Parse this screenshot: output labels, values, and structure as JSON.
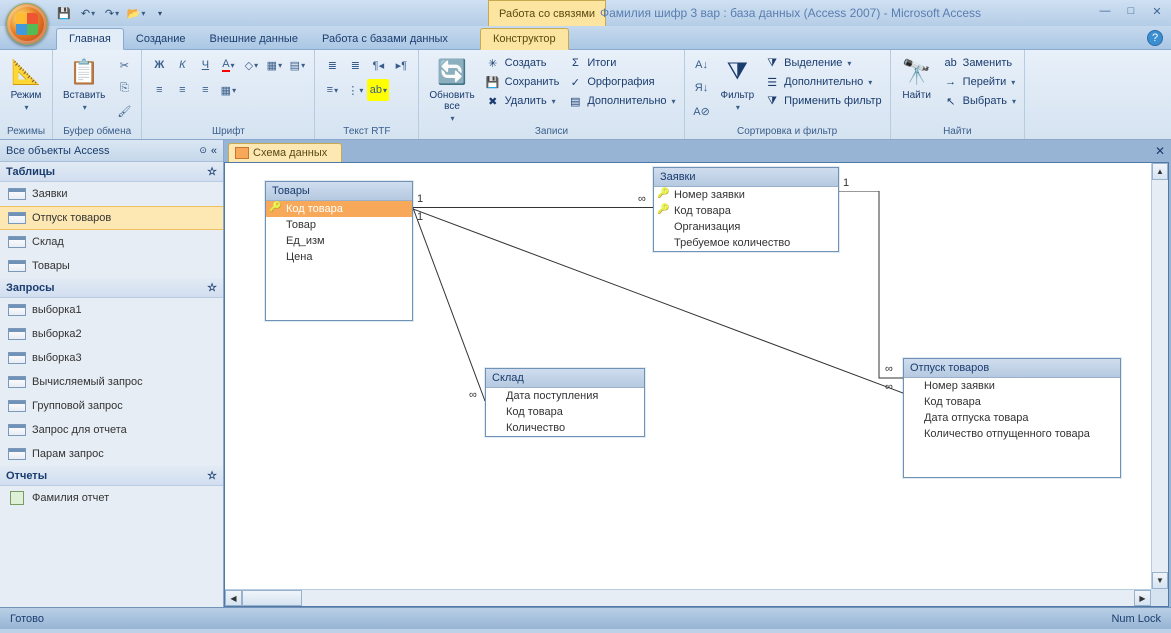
{
  "title": "Фамилия шифр 3 вар : база данных (Access 2007) - Microsoft Access",
  "context_tab": "Работа со связями",
  "tabs": {
    "main": "Главная",
    "create": "Создание",
    "external": "Внешние данные",
    "dbtools": "Работа с базами данных",
    "designer": "Конструктор"
  },
  "ribbon": {
    "modes": {
      "btn": "Режим",
      "label": "Режимы"
    },
    "clipboard": {
      "paste": "Вставить",
      "label": "Буфер обмена"
    },
    "font": {
      "label": "Шрифт"
    },
    "rtf": {
      "label": "Текст RTF"
    },
    "records": {
      "refresh": "Обновить\nвсе",
      "create": "Создать",
      "save": "Сохранить",
      "delete": "Удалить",
      "totals": "Итоги",
      "spell": "Орфография",
      "more": "Дополнительно",
      "label": "Записи"
    },
    "sort": {
      "filter": "Фильтр",
      "selection": "Выделение",
      "advanced": "Дополнительно",
      "apply": "Применить фильтр",
      "label": "Сортировка и фильтр"
    },
    "find": {
      "find": "Найти",
      "replace": "Заменить",
      "goto": "Перейти",
      "select": "Выбрать",
      "label": "Найти"
    }
  },
  "nav": {
    "header": "Все объекты Access",
    "cats": {
      "tables": "Таблицы",
      "queries": "Запросы",
      "reports": "Отчеты"
    },
    "tables": [
      "Заявки",
      "Отпуск товаров",
      "Склад",
      "Товары"
    ],
    "queries": [
      "выборка1",
      "выборка2",
      "выборка3",
      "Вычисляемый запрос",
      "Групповой запрос",
      "Запрос для отчета",
      "Парам запрос"
    ],
    "reports": [
      "Фамилия отчет"
    ]
  },
  "doctab": "Схема данных",
  "diagram": {
    "tovary": {
      "title": "Товары",
      "f": [
        "Код товара",
        "Товар",
        "Ед_изм",
        "Цена"
      ]
    },
    "zayavki": {
      "title": "Заявки",
      "f": [
        "Номер заявки",
        "Код товара",
        "Организация",
        "Требуемое количество"
      ]
    },
    "sklad": {
      "title": "Склад",
      "f": [
        "Дата поступления",
        "Код товара",
        "Количество"
      ]
    },
    "otpusk": {
      "title": "Отпуск товаров",
      "f": [
        "Номер заявки",
        "Код товара",
        "Дата отпуска товара",
        "Количество отпущенного товара"
      ]
    },
    "rel": {
      "one": "1",
      "many": "∞"
    }
  },
  "status": {
    "ready": "Готово",
    "numlock": "Num Lock"
  }
}
